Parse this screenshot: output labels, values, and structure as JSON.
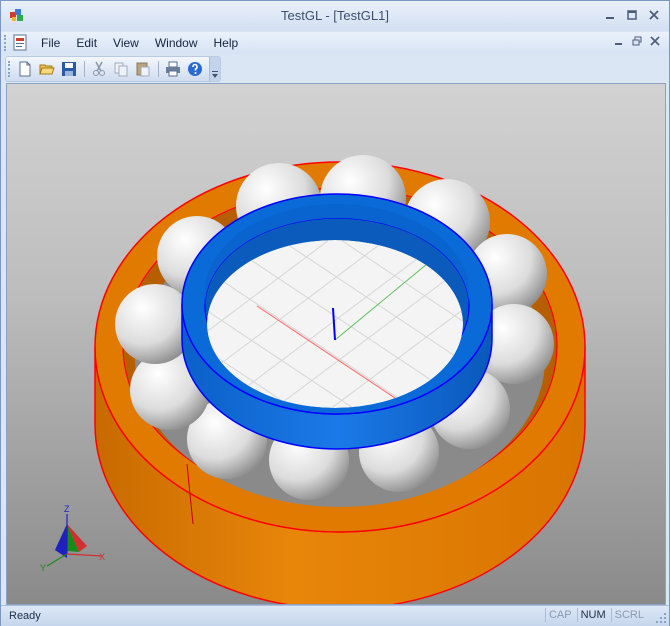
{
  "window": {
    "title": "TestGL - [TestGL1]",
    "caption_buttons": [
      "minimize",
      "maximize",
      "close"
    ]
  },
  "menubar": {
    "items": [
      "File",
      "Edit",
      "View",
      "Window",
      "Help"
    ],
    "mdi_buttons": [
      "minimize",
      "restore",
      "close"
    ]
  },
  "toolbar": {
    "buttons": [
      {
        "name": "new-icon",
        "tooltip": "New"
      },
      {
        "name": "open-icon",
        "tooltip": "Open"
      },
      {
        "name": "save-icon",
        "tooltip": "Save"
      },
      {
        "name": "cut-icon",
        "tooltip": "Cut"
      },
      {
        "name": "copy-icon",
        "tooltip": "Copy"
      },
      {
        "name": "paste-icon",
        "tooltip": "Paste"
      },
      {
        "name": "print-icon",
        "tooltip": "Print"
      },
      {
        "name": "help-icon",
        "tooltip": "About"
      }
    ]
  },
  "viewport": {
    "scene": "ball-bearing",
    "colors": {
      "outer_ring": "#e07a00",
      "outer_ring_edge": "#ff0000",
      "inner_ring": "#0a6ad8",
      "inner_ring_edge": "#0000ff",
      "balls": "#e8e8e8",
      "grid": "#ffffff",
      "background_top": "#d2d2d2",
      "background_bottom": "#8a8a8a"
    },
    "axis_triad": {
      "x": "X",
      "y": "Y",
      "z": "Z"
    }
  },
  "statusbar": {
    "text": "Ready",
    "indicators": [
      {
        "label": "CAP",
        "active": false
      },
      {
        "label": "NUM",
        "active": true
      },
      {
        "label": "SCRL",
        "active": false
      }
    ]
  }
}
